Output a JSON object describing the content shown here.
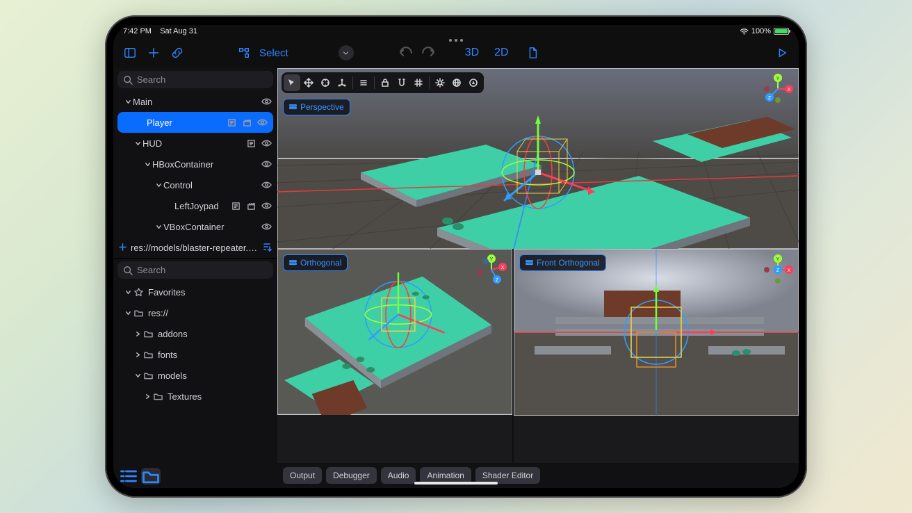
{
  "status": {
    "time": "7:42 PM",
    "date": "Sat Aug 31",
    "battery": "100%"
  },
  "toolbar": {
    "select_label": "Select",
    "mode_3d": "3D",
    "mode_2d": "2D"
  },
  "search_placeholder": "Search",
  "scene_tree": {
    "items": [
      {
        "label": "Main",
        "depth": 1,
        "selected": false,
        "expanded": true,
        "glyphs": [
          "eye"
        ],
        "chev": "down"
      },
      {
        "label": "Player",
        "depth": 2,
        "selected": true,
        "expanded": null,
        "glyphs": [
          "script",
          "clapper",
          "eye"
        ],
        "chev": null
      },
      {
        "label": "HUD",
        "depth": 2,
        "selected": false,
        "expanded": true,
        "glyphs": [
          "script",
          "eye"
        ],
        "chev": "down"
      },
      {
        "label": "HBoxContainer",
        "depth": 3,
        "selected": false,
        "expanded": true,
        "glyphs": [
          "eye"
        ],
        "chev": "down"
      },
      {
        "label": "Control",
        "depth": 4,
        "selected": false,
        "expanded": true,
        "glyphs": [
          "eye"
        ],
        "chev": "down"
      },
      {
        "label": "LeftJoypad",
        "depth": 5,
        "selected": false,
        "expanded": null,
        "glyphs": [
          "script",
          "clapper",
          "eye"
        ],
        "chev": null
      },
      {
        "label": "VBoxContainer",
        "depth": 4,
        "selected": false,
        "expanded": true,
        "glyphs": [
          "eye"
        ],
        "chev": "down"
      }
    ]
  },
  "resource_line": {
    "path": "res://models/blaster-repeater.…"
  },
  "filesystem": {
    "items": [
      {
        "label": "Favorites",
        "depth": 1,
        "chev": "down",
        "icon": "star"
      },
      {
        "label": "res://",
        "depth": 1,
        "chev": "down",
        "icon": "folder"
      },
      {
        "label": "addons",
        "depth": 2,
        "chev": "right",
        "icon": "folder"
      },
      {
        "label": "fonts",
        "depth": 2,
        "chev": "right",
        "icon": "folder"
      },
      {
        "label": "models",
        "depth": 2,
        "chev": "down",
        "icon": "folder"
      },
      {
        "label": "Textures",
        "depth": 3,
        "chev": "right",
        "icon": "folder"
      }
    ]
  },
  "viewports": {
    "top": "Perspective",
    "bottom_left": "Orthogonal",
    "bottom_right": "Front Orthogonal"
  },
  "axes": {
    "x": "X",
    "y": "Y",
    "z": "Z"
  },
  "bottom_tabs": [
    "Output",
    "Debugger",
    "Audio",
    "Animation",
    "Shader Editor"
  ]
}
